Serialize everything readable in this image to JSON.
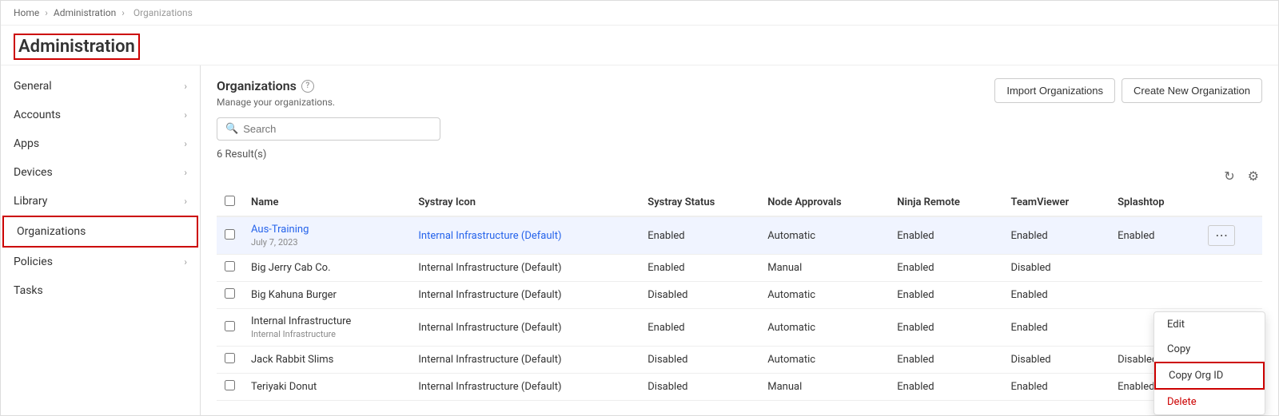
{
  "breadcrumb": {
    "items": [
      "Home",
      "Administration",
      "Organizations"
    ]
  },
  "page_title": "Administration",
  "sidebar": {
    "items": [
      {
        "id": "general",
        "label": "General",
        "has_chevron": true,
        "active": false
      },
      {
        "id": "accounts",
        "label": "Accounts",
        "has_chevron": true,
        "active": false
      },
      {
        "id": "apps",
        "label": "Apps",
        "has_chevron": true,
        "active": false
      },
      {
        "id": "devices",
        "label": "Devices",
        "has_chevron": true,
        "active": false
      },
      {
        "id": "library",
        "label": "Library",
        "has_chevron": true,
        "active": false
      },
      {
        "id": "organizations",
        "label": "Organizations",
        "has_chevron": false,
        "active": true
      },
      {
        "id": "policies",
        "label": "Policies",
        "has_chevron": true,
        "active": false
      },
      {
        "id": "tasks",
        "label": "Tasks",
        "has_chevron": false,
        "active": false
      }
    ]
  },
  "content": {
    "title": "Organizations",
    "subtitle": "Manage your organizations.",
    "import_button": "Import Organizations",
    "create_button": "Create New Organization",
    "search_placeholder": "Search",
    "results_count": "6 Result(s)",
    "table": {
      "columns": [
        "",
        "Name",
        "Systray Icon",
        "Systray Status",
        "Node Approvals",
        "Ninja Remote",
        "TeamViewer",
        "Splashtop",
        ""
      ],
      "rows": [
        {
          "id": 1,
          "name": "Aus-Training",
          "date": "July 7, 2023",
          "systray_icon": "Internal Infrastructure (Default)",
          "systray_status": "Enabled",
          "node_approvals": "Automatic",
          "ninja_remote": "Enabled",
          "teamviewer": "Enabled",
          "splashtop": "Enabled",
          "highlighted": true,
          "show_menu": true
        },
        {
          "id": 2,
          "name": "Big Jerry Cab Co.",
          "date": "",
          "systray_icon": "Internal Infrastructure (Default)",
          "systray_status": "Enabled",
          "node_approvals": "Manual",
          "ninja_remote": "Enabled",
          "teamviewer": "Disabled",
          "splashtop": "",
          "highlighted": false,
          "show_menu": false
        },
        {
          "id": 3,
          "name": "Big Kahuna Burger",
          "date": "",
          "systray_icon": "Internal Infrastructure (Default)",
          "systray_status": "Disabled",
          "node_approvals": "Automatic",
          "ninja_remote": "Enabled",
          "teamviewer": "Enabled",
          "splashtop": "",
          "highlighted": false,
          "show_menu": false
        },
        {
          "id": 4,
          "name": "Internal Infrastructure",
          "name2": "Internal Infrastructure",
          "date": "",
          "systray_icon": "Internal Infrastructure (Default)",
          "systray_status": "Enabled",
          "node_approvals": "Automatic",
          "ninja_remote": "Enabled",
          "teamviewer": "Enabled",
          "splashtop": "",
          "highlighted": false,
          "show_menu": false
        },
        {
          "id": 5,
          "name": "Jack Rabbit Slims",
          "date": "",
          "systray_icon": "Internal Infrastructure (Default)",
          "systray_status": "Disabled",
          "node_approvals": "Automatic",
          "ninja_remote": "Enabled",
          "teamviewer": "Disabled",
          "splashtop": "Disabled",
          "highlighted": false,
          "show_menu": false
        },
        {
          "id": 6,
          "name": "Teriyaki Donut",
          "date": "",
          "systray_icon": "Internal Infrastructure (Default)",
          "systray_status": "Disabled",
          "node_approvals": "Manual",
          "ninja_remote": "Enabled",
          "teamviewer": "Enabled",
          "splashtop": "Enabled",
          "highlighted": false,
          "show_menu": false
        }
      ]
    },
    "dropdown_menu": {
      "items": [
        {
          "id": "edit",
          "label": "Edit",
          "type": "normal"
        },
        {
          "id": "copy",
          "label": "Copy",
          "type": "normal"
        },
        {
          "id": "copy-org-id",
          "label": "Copy Org ID",
          "type": "highlighted"
        },
        {
          "id": "delete",
          "label": "Delete",
          "type": "delete"
        }
      ]
    }
  }
}
